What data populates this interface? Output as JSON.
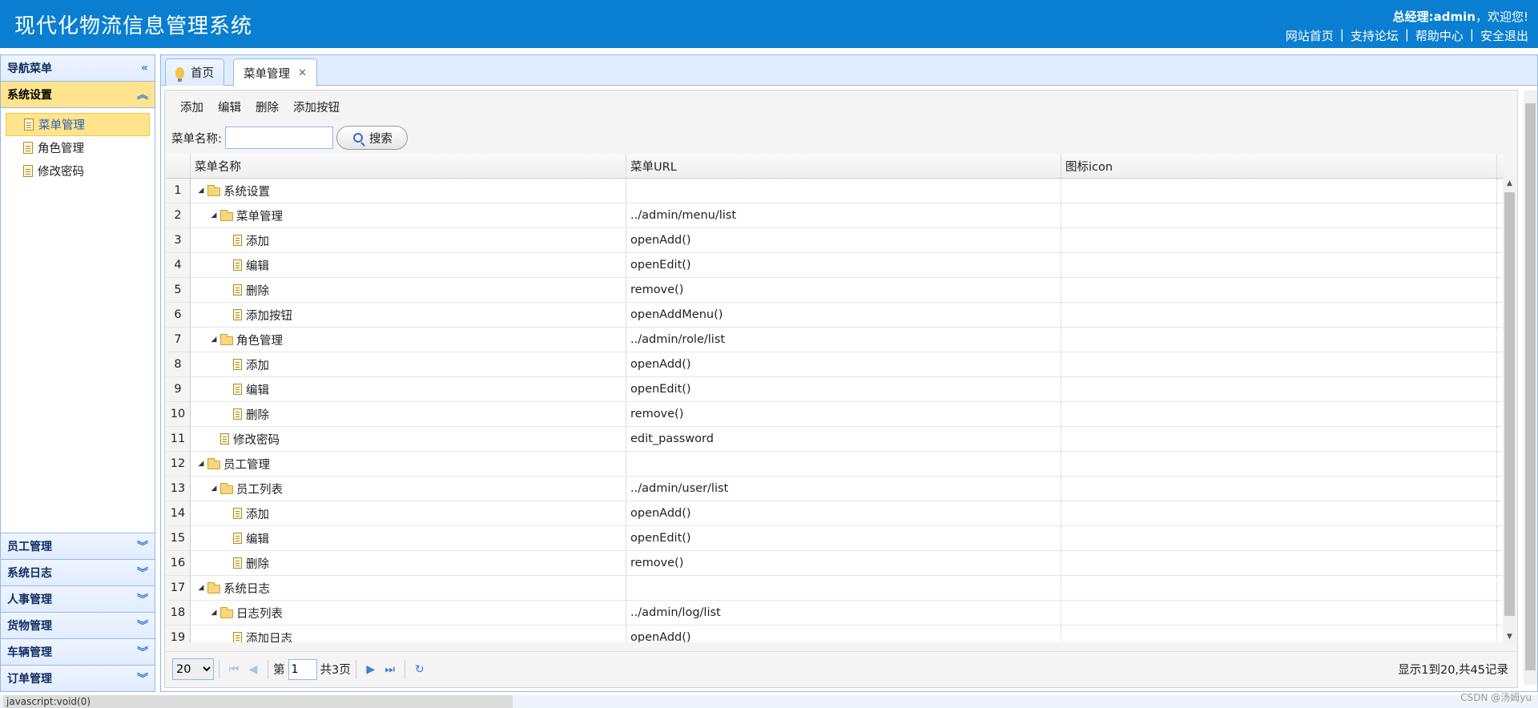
{
  "header": {
    "app_title": "现代化物流信息管理系统",
    "welcome_role": "总经理:admin",
    "welcome_text": "，欢迎您!",
    "links": [
      "网站首页",
      "支持论坛",
      "帮助中心",
      "安全退出"
    ]
  },
  "sidebar": {
    "title": "导航菜单",
    "active_group": "系统设置",
    "items": [
      "菜单管理",
      "角色管理",
      "修改密码"
    ],
    "collapsed_groups": [
      "员工管理",
      "系统日志",
      "人事管理",
      "货物管理",
      "车辆管理",
      "订单管理"
    ]
  },
  "tabs": [
    {
      "label": "首页"
    },
    {
      "label": "菜单管理"
    }
  ],
  "toolbar": {
    "add_label": "添加",
    "edit_label": "编辑",
    "delete_label": "删除",
    "add_button_label": "添加按钮"
  },
  "search": {
    "label": "菜单名称:",
    "value": "",
    "button_label": "搜索"
  },
  "grid": {
    "columns": [
      "菜单名称",
      "菜单URL",
      "图标icon"
    ],
    "rows": [
      {
        "n": "1",
        "level": 0,
        "type": "folder",
        "name": "系统设置",
        "url": "",
        "icon": ""
      },
      {
        "n": "2",
        "level": 1,
        "type": "folder",
        "name": "菜单管理",
        "url": "../admin/menu/list",
        "icon": ""
      },
      {
        "n": "3",
        "level": 2,
        "type": "leaf",
        "name": "添加",
        "url": "openAdd()",
        "icon": ""
      },
      {
        "n": "4",
        "level": 2,
        "type": "leaf",
        "name": "编辑",
        "url": "openEdit()",
        "icon": ""
      },
      {
        "n": "5",
        "level": 2,
        "type": "leaf",
        "name": "删除",
        "url": "remove()",
        "icon": ""
      },
      {
        "n": "6",
        "level": 2,
        "type": "leaf",
        "name": "添加按钮",
        "url": "openAddMenu()",
        "icon": ""
      },
      {
        "n": "7",
        "level": 1,
        "type": "folder",
        "name": "角色管理",
        "url": "../admin/role/list",
        "icon": ""
      },
      {
        "n": "8",
        "level": 2,
        "type": "leaf",
        "name": "添加",
        "url": "openAdd()",
        "icon": ""
      },
      {
        "n": "9",
        "level": 2,
        "type": "leaf",
        "name": "编辑",
        "url": "openEdit()",
        "icon": ""
      },
      {
        "n": "10",
        "level": 2,
        "type": "leaf",
        "name": "删除",
        "url": "remove()",
        "icon": ""
      },
      {
        "n": "11",
        "level": 1,
        "type": "leaf",
        "name": "修改密码",
        "url": "edit_password",
        "icon": ""
      },
      {
        "n": "12",
        "level": 0,
        "type": "folder",
        "name": "员工管理",
        "url": "",
        "icon": ""
      },
      {
        "n": "13",
        "level": 1,
        "type": "folder",
        "name": "员工列表",
        "url": "../admin/user/list",
        "icon": ""
      },
      {
        "n": "14",
        "level": 2,
        "type": "leaf",
        "name": "添加",
        "url": "openAdd()",
        "icon": ""
      },
      {
        "n": "15",
        "level": 2,
        "type": "leaf",
        "name": "编辑",
        "url": "openEdit()",
        "icon": ""
      },
      {
        "n": "16",
        "level": 2,
        "type": "leaf",
        "name": "删除",
        "url": "remove()",
        "icon": ""
      },
      {
        "n": "17",
        "level": 0,
        "type": "folder",
        "name": "系统日志",
        "url": "",
        "icon": ""
      },
      {
        "n": "18",
        "level": 1,
        "type": "folder",
        "name": "日志列表",
        "url": "../admin/log/list",
        "icon": ""
      },
      {
        "n": "19",
        "level": 2,
        "type": "leaf",
        "name": "添加日志",
        "url": "openAdd()",
        "icon": ""
      }
    ]
  },
  "pager": {
    "page_size": "20",
    "page_prefix": "第",
    "page_value": "1",
    "page_suffix": "共3页",
    "info": "显示1到20,共45记录"
  },
  "statusbar": {
    "text": "javascript:void(0)",
    "watermark": "CSDN @汤姆yu"
  },
  "colors": {
    "header_bg": "#0a7fd1",
    "active_highlight": "#ffe48d",
    "border": "#95b8e7"
  }
}
